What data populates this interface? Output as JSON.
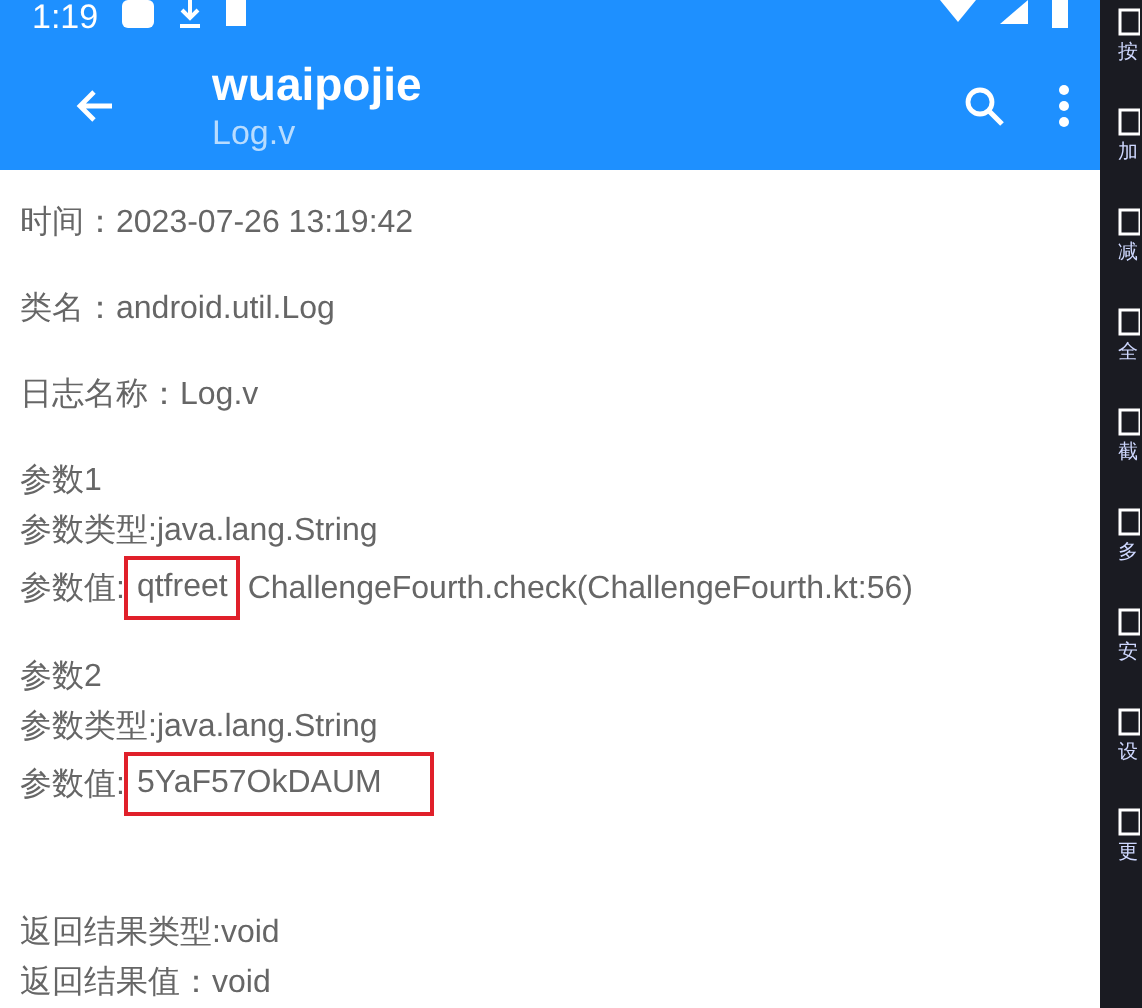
{
  "status_bar": {
    "time": "1:19"
  },
  "app_bar": {
    "title": "wuaipojie",
    "subtitle": "Log.v"
  },
  "fields": [
    {
      "label": "时间：",
      "value": "2023-07-26 13:19:42"
    },
    {
      "label": "类名：",
      "value": "android.util.Log"
    },
    {
      "label": "日志名称：",
      "value": "Log.v"
    }
  ],
  "params": [
    {
      "title": "参数1",
      "type_line": "参数类型:java.lang.String",
      "value_label": "参数值:",
      "value": "qtfreet",
      "value_rest": "ChallengeFourth.check(ChallengeFourth.kt:56)",
      "highlighted": true,
      "wide": false
    },
    {
      "title": "参数2",
      "type_line": "参数类型:java.lang.String",
      "value_label": "参数值:",
      "value": "5YaF57OkDAUM",
      "highlighted": true,
      "wide": true
    }
  ],
  "result": {
    "type_line": "返回结果类型:void",
    "value_line": "返回结果值：void"
  },
  "side_toolbar": [
    {
      "label": "按"
    },
    {
      "label": "加"
    },
    {
      "label": "减"
    },
    {
      "label": "全"
    },
    {
      "label": "截"
    },
    {
      "label": "多"
    },
    {
      "label": "安"
    },
    {
      "label": "设"
    },
    {
      "label": "更"
    }
  ]
}
